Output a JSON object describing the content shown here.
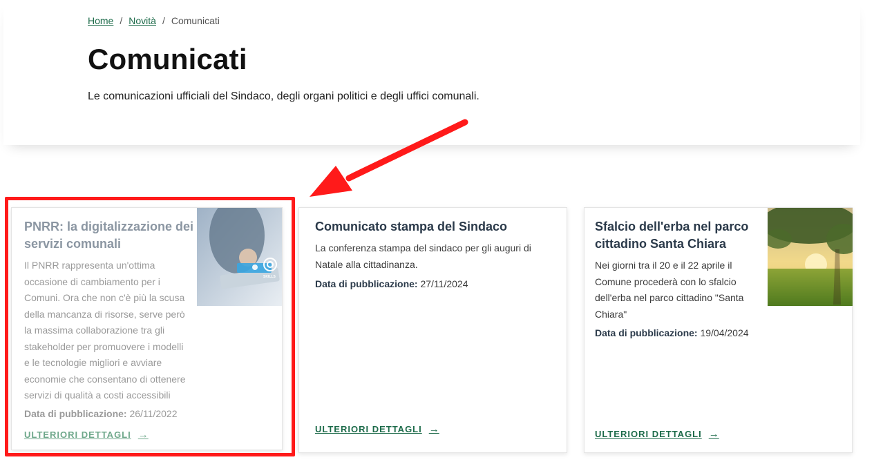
{
  "breadcrumb": {
    "items": [
      "Home",
      "Novità"
    ],
    "current": "Comunicati",
    "separator": "/"
  },
  "header": {
    "title": "Comunicati",
    "description": "Le comunicazioni ufficiali del Sindaco, degli organi politici e degli uffici comunali."
  },
  "cards": [
    {
      "title_line1": "PNRR: la digitalizzazione dei",
      "title_line2": "servizi comunali",
      "text_lines": [
        "Il PNRR rappresenta un'ottima",
        "occasione di cambiamento per i",
        "Comuni. Ora che non c'è più la scusa",
        "della mancanza di risorse, serve però",
        "la massima collaborazione tra gli",
        "stakeholder per promuovere i modelli",
        "e le tecnologie migliori e avviare",
        "economie che consentano di ottenere",
        "servizi di qualità a costi accessibili"
      ],
      "pub_label": "Data di pubblicazione:",
      "pub_date": "26/11/2022",
      "more_label": "ULTERIORI DETTAGLI",
      "image_icon": "tablet-digital-icon",
      "image_caption": "SKILLS"
    },
    {
      "title_line1": "Comunicato stampa del Sindaco",
      "text_lines": [
        "La conferenza stampa del sindaco per gli auguri di",
        "Natale alla cittadinanza."
      ],
      "pub_label": "Data di pubblicazione:",
      "pub_date": "27/11/2024",
      "more_label": "ULTERIORI DETTAGLI"
    },
    {
      "title_line1": "Sfalcio dell'erba nel parco",
      "title_line2": "cittadino Santa Chiara",
      "text_lines": [
        "Nei giorni tra il 20 e il 22 aprile il",
        "Comune procederà con lo sfalcio",
        "dell'erba nel parco cittadino \"Santa",
        "Chiara\""
      ],
      "pub_label": "Data di pubblicazione:",
      "pub_date": "19/04/2024",
      "more_label": "ULTERIORI DETTAGLI",
      "image_icon": "park-tree-icon"
    }
  ],
  "arrow_glyph": "→",
  "colors": {
    "link_green": "#1d6b4a",
    "highlight_red": "#ff1a1a",
    "title_dark": "#2b3a4a"
  }
}
